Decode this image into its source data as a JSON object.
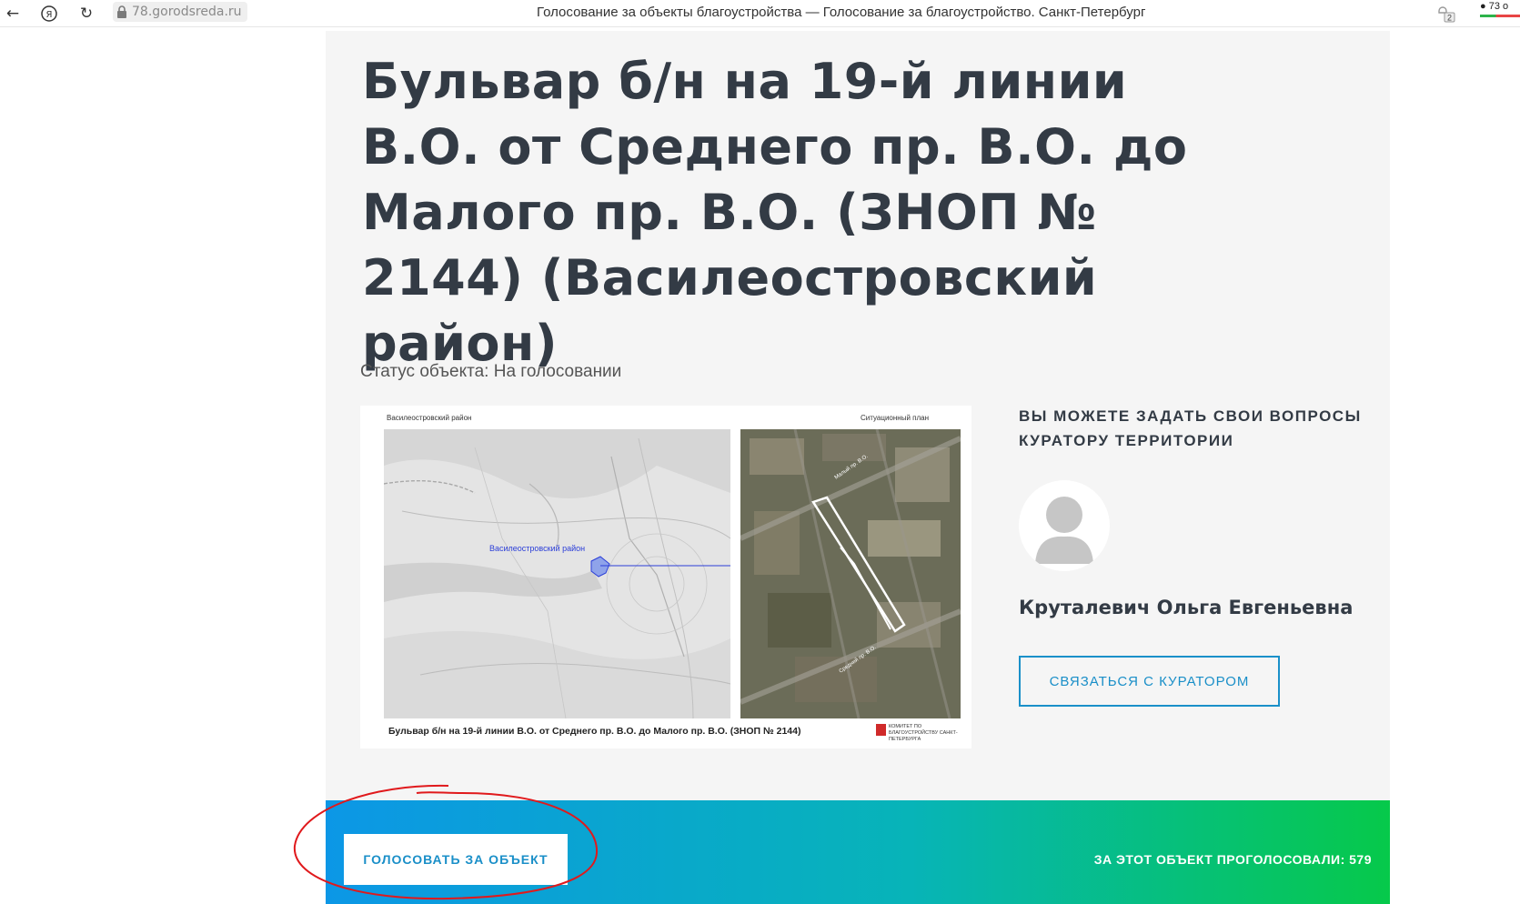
{
  "browser": {
    "url": "78.gorodsreda.ru",
    "tab_title": "Голосование за объекты благоустройства — Голосование за благоустройство. Санкт-Петербург",
    "ext_badge": "2",
    "comment_count": "73 о"
  },
  "object": {
    "title": "Бульвар б/н на 19-й линии В.О. от Среднего пр. В.О. до Малого пр. В.О. (ЗНОП № 2144) (Василеостровский район)",
    "status": "Статус объекта: На голосовании"
  },
  "image": {
    "label_left": "Василеостровский район",
    "label_right": "Ситуационный план",
    "district_label": "Василеостровский район",
    "caption": "Бульвар б/н на 19-й линии В.О. от Среднего пр. В.О. до Малого пр. В.О. (ЗНОП № 2144)",
    "logo_text": "КОМИТЕТ ПО БЛАГОУСТРОЙСТВУ САНКТ-ПЕТЕРБУРГА",
    "street_label_top": "Малый пр. В.О.",
    "street_label_bottom": "Средний пр. В.О."
  },
  "curator": {
    "heading": "ВЫ МОЖЕТЕ ЗАДАТЬ СВОИ ВОПРОСЫ КУРАТОРУ ТЕРРИТОРИИ",
    "name": "Круталевич Ольга Евгеньевна",
    "contact_label": "СВЯЗАТЬСЯ С КУРАТОРОМ"
  },
  "vote": {
    "button_label": "ГОЛОСОВАТЬ ЗА ОБЪЕКТ",
    "count_text": "ЗА ЭТОТ ОБЪЕКТ ПРОГОЛОСОВАЛИ: 579"
  },
  "colors": {
    "accent": "#1a8fc8",
    "title": "#333b45",
    "gradient_start": "#0c97e6",
    "gradient_end": "#06c94a",
    "annotation": "#e0191c"
  },
  "icons": [
    "back-arrow-icon",
    "yandex-icon",
    "reload-icon",
    "lock-icon",
    "extension-icon",
    "comment-icon",
    "user-silhouette-icon"
  ]
}
